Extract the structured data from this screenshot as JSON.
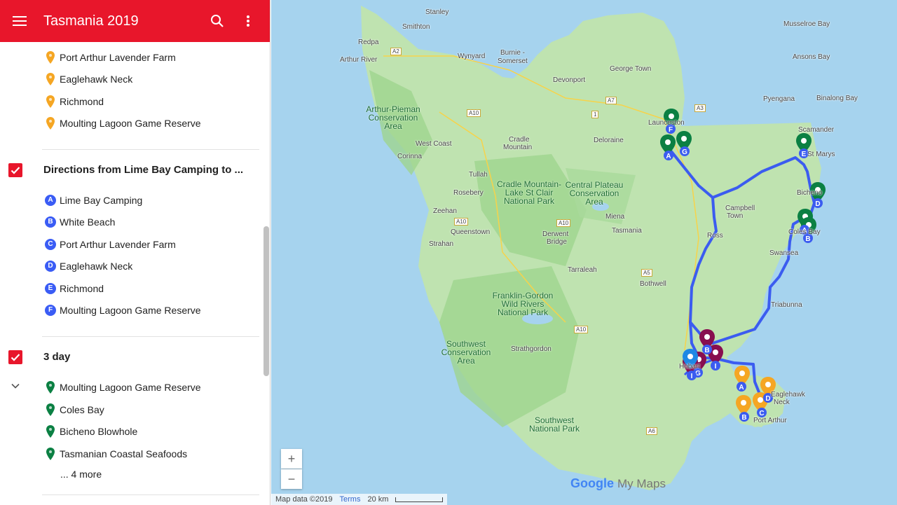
{
  "header": {
    "title": "Tasmania 2019",
    "menu_icon": "menu-icon",
    "search_icon": "search-icon",
    "more_icon": "more-vert-icon"
  },
  "colors": {
    "header_bg": "#e8162b",
    "pin_orange": "#f5a623",
    "pin_green": "#0b8043",
    "pin_purple": "#880e4f",
    "route_blue": "#3b5cf0",
    "water": "#a6d3ee",
    "land": "#bfe3b0"
  },
  "layer1": {
    "items": [
      {
        "label": "Port Arthur Lavender Farm"
      },
      {
        "label": "Eaglehawk Neck"
      },
      {
        "label": "Richmond"
      },
      {
        "label": "Moulting Lagoon Game Reserve"
      }
    ]
  },
  "layer2": {
    "title": "Directions from Lime Bay Camping to ...",
    "items": [
      {
        "letter": "A",
        "label": "Lime Bay Camping"
      },
      {
        "letter": "B",
        "label": "White Beach"
      },
      {
        "letter": "C",
        "label": "Port Arthur Lavender Farm"
      },
      {
        "letter": "D",
        "label": "Eaglehawk Neck"
      },
      {
        "letter": "E",
        "label": "Richmond"
      },
      {
        "letter": "F",
        "label": "Moulting Lagoon Game Reserve"
      }
    ]
  },
  "layer3": {
    "title": "3 day",
    "items": [
      {
        "label": "Moulting Lagoon Game Reserve"
      },
      {
        "label": "Coles Bay"
      },
      {
        "label": "Bicheno Blowhole"
      },
      {
        "label": "Tasmanian Coastal Seafoods"
      }
    ],
    "more": "... 4 more"
  },
  "map": {
    "places": [
      {
        "name": "Stanley"
      },
      {
        "name": "Smithton"
      },
      {
        "name": "Redpa"
      },
      {
        "name": "Wynyard"
      },
      {
        "name": "Burnie -"
      },
      {
        "name": "Somerset"
      },
      {
        "name": "Arthur River"
      },
      {
        "name": "Devonport"
      },
      {
        "name": "George Town"
      },
      {
        "name": "Musselroe Bay"
      },
      {
        "name": "Ansons Bay"
      },
      {
        "name": "Pyengana"
      },
      {
        "name": "Binalong Bay"
      },
      {
        "name": "Scamander"
      },
      {
        "name": "St Marys"
      },
      {
        "name": "Launceston"
      },
      {
        "name": "Deloraine"
      },
      {
        "name": "West Coast"
      },
      {
        "name": "Corinna"
      },
      {
        "name": "Tullah"
      },
      {
        "name": "Rosebery"
      },
      {
        "name": "Zeehan"
      },
      {
        "name": "Queenstown"
      },
      {
        "name": "Strahan"
      },
      {
        "name": "Miena"
      },
      {
        "name": "Tasmania"
      },
      {
        "name": "Campbell"
      },
      {
        "name": "Town"
      },
      {
        "name": "Ross"
      },
      {
        "name": "Derwent"
      },
      {
        "name": "Bridge"
      },
      {
        "name": "Tarraleah"
      },
      {
        "name": "Bothwell"
      },
      {
        "name": "Bicheno"
      },
      {
        "name": "Coles Bay"
      },
      {
        "name": "Swansea"
      },
      {
        "name": "Triabunna"
      },
      {
        "name": "Strathgordon"
      },
      {
        "name": "Hobart"
      },
      {
        "name": "Eaglehawk"
      },
      {
        "name": "Neck"
      },
      {
        "name": "Port Arthur"
      },
      {
        "name": "Cradle"
      },
      {
        "name": "Mountain"
      }
    ],
    "parks": [
      {
        "name": "Arthur-Pieman Conservation Area"
      },
      {
        "name": "Cradle Mountain-Lake St Clair National Park"
      },
      {
        "name": "Central Plateau Conservation Area"
      },
      {
        "name": "Franklin-Gordon Wild Rivers National Park"
      },
      {
        "name": "Southwest Conservation Area"
      },
      {
        "name": "Southwest National Park"
      }
    ],
    "roads": [
      "A2",
      "A10",
      "A10",
      "A10",
      "A7",
      "A3",
      "1",
      "A5",
      "A6",
      "A10",
      "A10"
    ],
    "zoom_in": "+",
    "zoom_out": "−",
    "logo_google": "Google",
    "logo_mymaps": "My Maps",
    "attribution": {
      "data": "Map data ©2019",
      "terms": "Terms",
      "scale": "20 km"
    }
  }
}
